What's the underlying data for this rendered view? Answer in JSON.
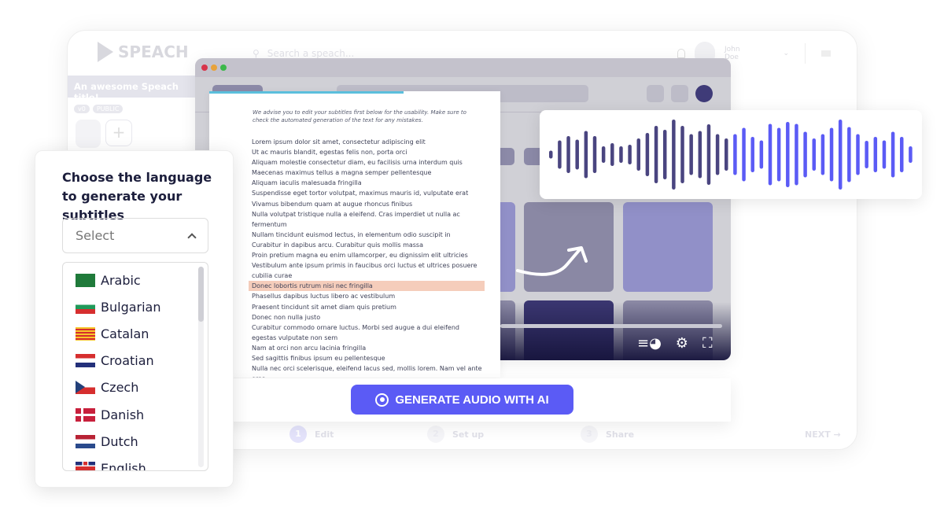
{
  "app": {
    "logo": "SPEACH",
    "search_placeholder": "Search a speach...",
    "user_name": "John Doe",
    "speach_title": "An awesome Speach title!",
    "version_badge": "v0",
    "visibility_badge": "PUBLIC",
    "add_label": "+",
    "steps": [
      {
        "num": "1",
        "label": "Edit"
      },
      {
        "num": "2",
        "label": "Set up"
      },
      {
        "num": "3",
        "label": "Share"
      }
    ],
    "next_label": "NEXT →"
  },
  "editor": {
    "advice": "We advise you to edit your subtitles first below for the usability. Make sure to check the automated generation of the text for any mistakes.",
    "lines": [
      "Lorem ipsum dolor sit amet, consectetur adipiscing elit",
      "Ut ac mauris blandit, egestas felis non, porta orci",
      "Aliquam molestie consectetur diam, eu facilisis urna interdum quis",
      "Maecenas maximus tellus a magna semper pellentesque",
      "Aliquam iaculis malesuada fringilla",
      "Suspendisse eget tortor volutpat, maximus mauris id, vulputate erat",
      "Vivamus bibendum quam at augue rhoncus finibus",
      "Nulla volutpat tristique nulla a eleifend. Cras imperdiet ut nulla ac fermentum",
      "Nullam tincidunt euismod lectus, in elementum odio suscipit in",
      "Curabitur in dapibus arcu. Curabitur quis mollis massa",
      "Proin pretium magna eu enim ullamcorper, eu dignissim elit ultricies",
      "Vestibulum ante ipsum primis in faucibus orci luctus et ultrices posuere cubilia curae",
      "Donec lobortis rutrum nisi nec fringilla",
      "Phasellus dapibus luctus libero ac vestibulum",
      "Praesent tincidunt sit amet diam quis pretium",
      "Donec non nulla justo",
      "Curabitur commodo ornare luctus. Morbi sed augue a dui eleifend egestas vulputate non sem",
      "Nam at orci non arcu lacinia fringilla",
      "Sed sagittis finibus ipsum eu pellentesque",
      "Nulla nec orci scelerisque, eleifend lacus sed, mollis lorem. Nam vel ante eros"
    ],
    "highlighted_line": 12
  },
  "generate_button": {
    "label": "GENERATE AUDIO WITH AI",
    "icon": "record-icon"
  },
  "waveform": {
    "played_color": "#4a4580",
    "unplayed_color": "#5b5bf5",
    "played_bars": 21,
    "levels": [
      10,
      36,
      47,
      38,
      60,
      47,
      21,
      29,
      21,
      25,
      41,
      55,
      73,
      63,
      89,
      73,
      52,
      60,
      77,
      52,
      41,
      52,
      68,
      45,
      36,
      78,
      68,
      83,
      78,
      58,
      41,
      52,
      68,
      89,
      70,
      52,
      35,
      45,
      36,
      58,
      45,
      21
    ]
  },
  "language_picker": {
    "title": "Choose the language to generate your subtitles",
    "select_placeholder": "Select",
    "options": [
      {
        "label": "Arabic",
        "flag": "sa"
      },
      {
        "label": "Bulgarian",
        "flag": "bg"
      },
      {
        "label": "Catalan",
        "flag": "ca"
      },
      {
        "label": "Croatian",
        "flag": "hr"
      },
      {
        "label": "Czech",
        "flag": "cz"
      },
      {
        "label": "Danish",
        "flag": "dk"
      },
      {
        "label": "Dutch",
        "flag": "nl"
      },
      {
        "label": "English",
        "flag": "gb"
      }
    ]
  },
  "colors": {
    "accent": "#5b5bf5",
    "dark": "#3f3b78",
    "highlight": "#f5cdbb",
    "progress_line": "#5bbfdc"
  }
}
